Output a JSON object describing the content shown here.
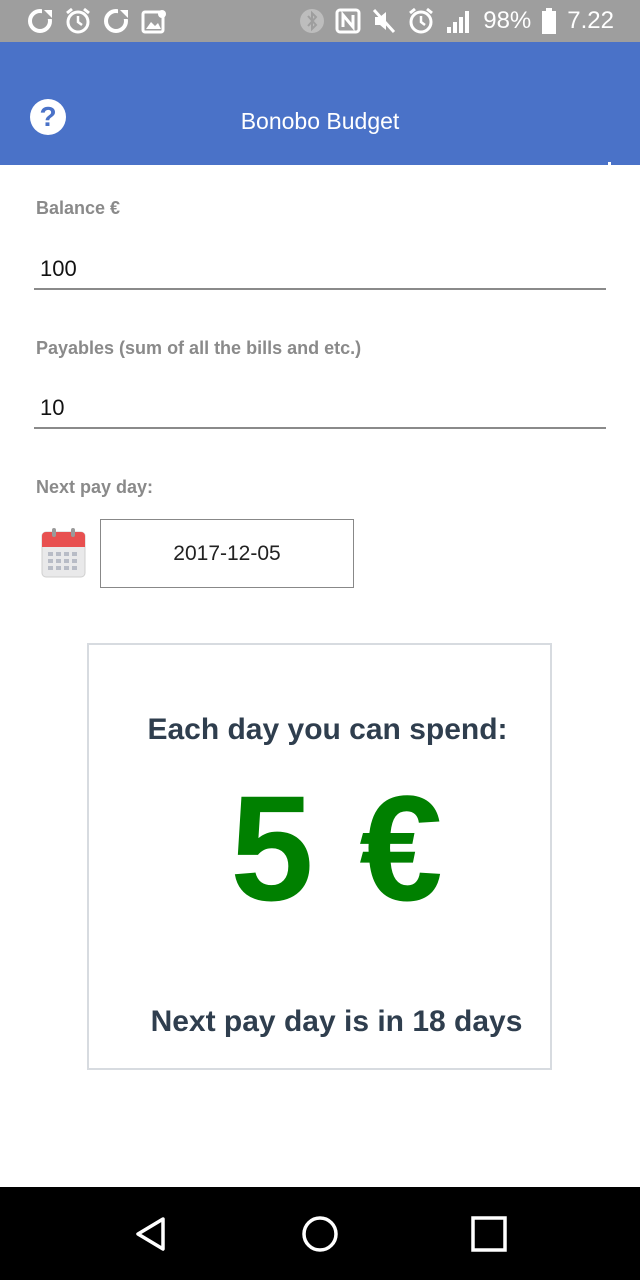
{
  "status_bar": {
    "battery_text": "98%",
    "time": "7.22",
    "left_icons": [
      "sync-icon",
      "alarm-icon",
      "sync-icon",
      "gallery-icon"
    ],
    "right_icons": [
      "bluetooth-icon",
      "nfc-icon",
      "mute-icon",
      "alarm-icon",
      "signal-icon",
      "battery-icon"
    ]
  },
  "app_bar": {
    "title": "Bonobo Budget",
    "help_glyph": "?",
    "color": "#4a72c8"
  },
  "form": {
    "balance_label": "Balance €",
    "balance_value": "100",
    "payables_label": "Payables (sum of all the bills and etc.)",
    "payables_value": "10",
    "next_pay_day_label": "Next pay day:",
    "next_pay_day_value": "2017-12-05"
  },
  "result": {
    "heading": "Each day you can spend:",
    "amount": "5 €",
    "amount_color": "#008000",
    "next_pay_day_note": "Next pay day is in 18 days"
  },
  "nav_bar": {
    "buttons": [
      "back-icon",
      "home-icon",
      "recents-icon"
    ]
  }
}
